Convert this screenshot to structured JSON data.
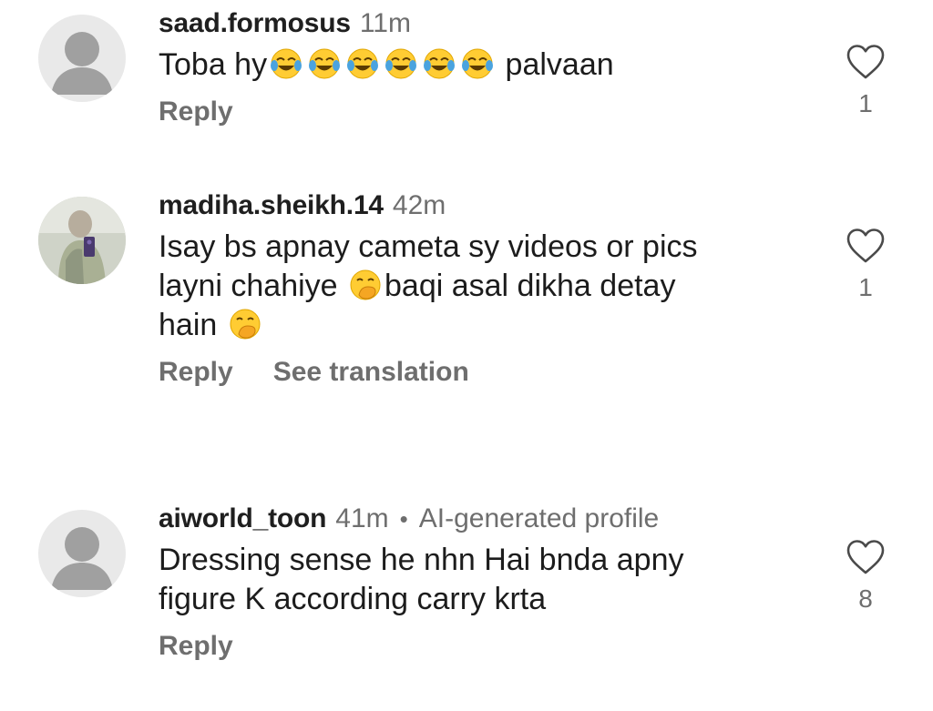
{
  "comments": [
    {
      "username": "saad.formosus",
      "time": "11m",
      "text_before": "Toba hy",
      "text_after": " palvaan",
      "emoji": "face-with-tears-of-joy",
      "emoji_count": 6,
      "reply_label": "Reply",
      "likes": "1",
      "avatar": "default-avatar"
    },
    {
      "username": "madiha.sheikh.14",
      "time": "42m",
      "line1": "Isay bs apnay cameta sy videos or pics",
      "line2_before": "layni chahiye ",
      "line2_after": "baqi asal dikha detay",
      "line3": "hain ",
      "emoji": "face-with-hand-over-mouth",
      "reply_label": "Reply",
      "translate_label": "See translation",
      "likes": "1",
      "avatar": "photo-avatar"
    },
    {
      "username": "aiworld_toon",
      "time": "41m",
      "separator": "•",
      "ai_label": "AI-generated profile",
      "line1": "Dressing sense he nhn Hai bnda apny",
      "line2": "figure K according carry krta",
      "reply_label": "Reply",
      "likes": "8",
      "avatar": "default-avatar"
    }
  ],
  "colors": {
    "text": "#1c1c1c",
    "secondary": "#6e6e6e",
    "avatar_bg": "#e9e9e9",
    "avatar_fg": "#a0a0a0",
    "emoji_yellow": "#ffcc33",
    "emoji_tear": "#4aa3df"
  }
}
